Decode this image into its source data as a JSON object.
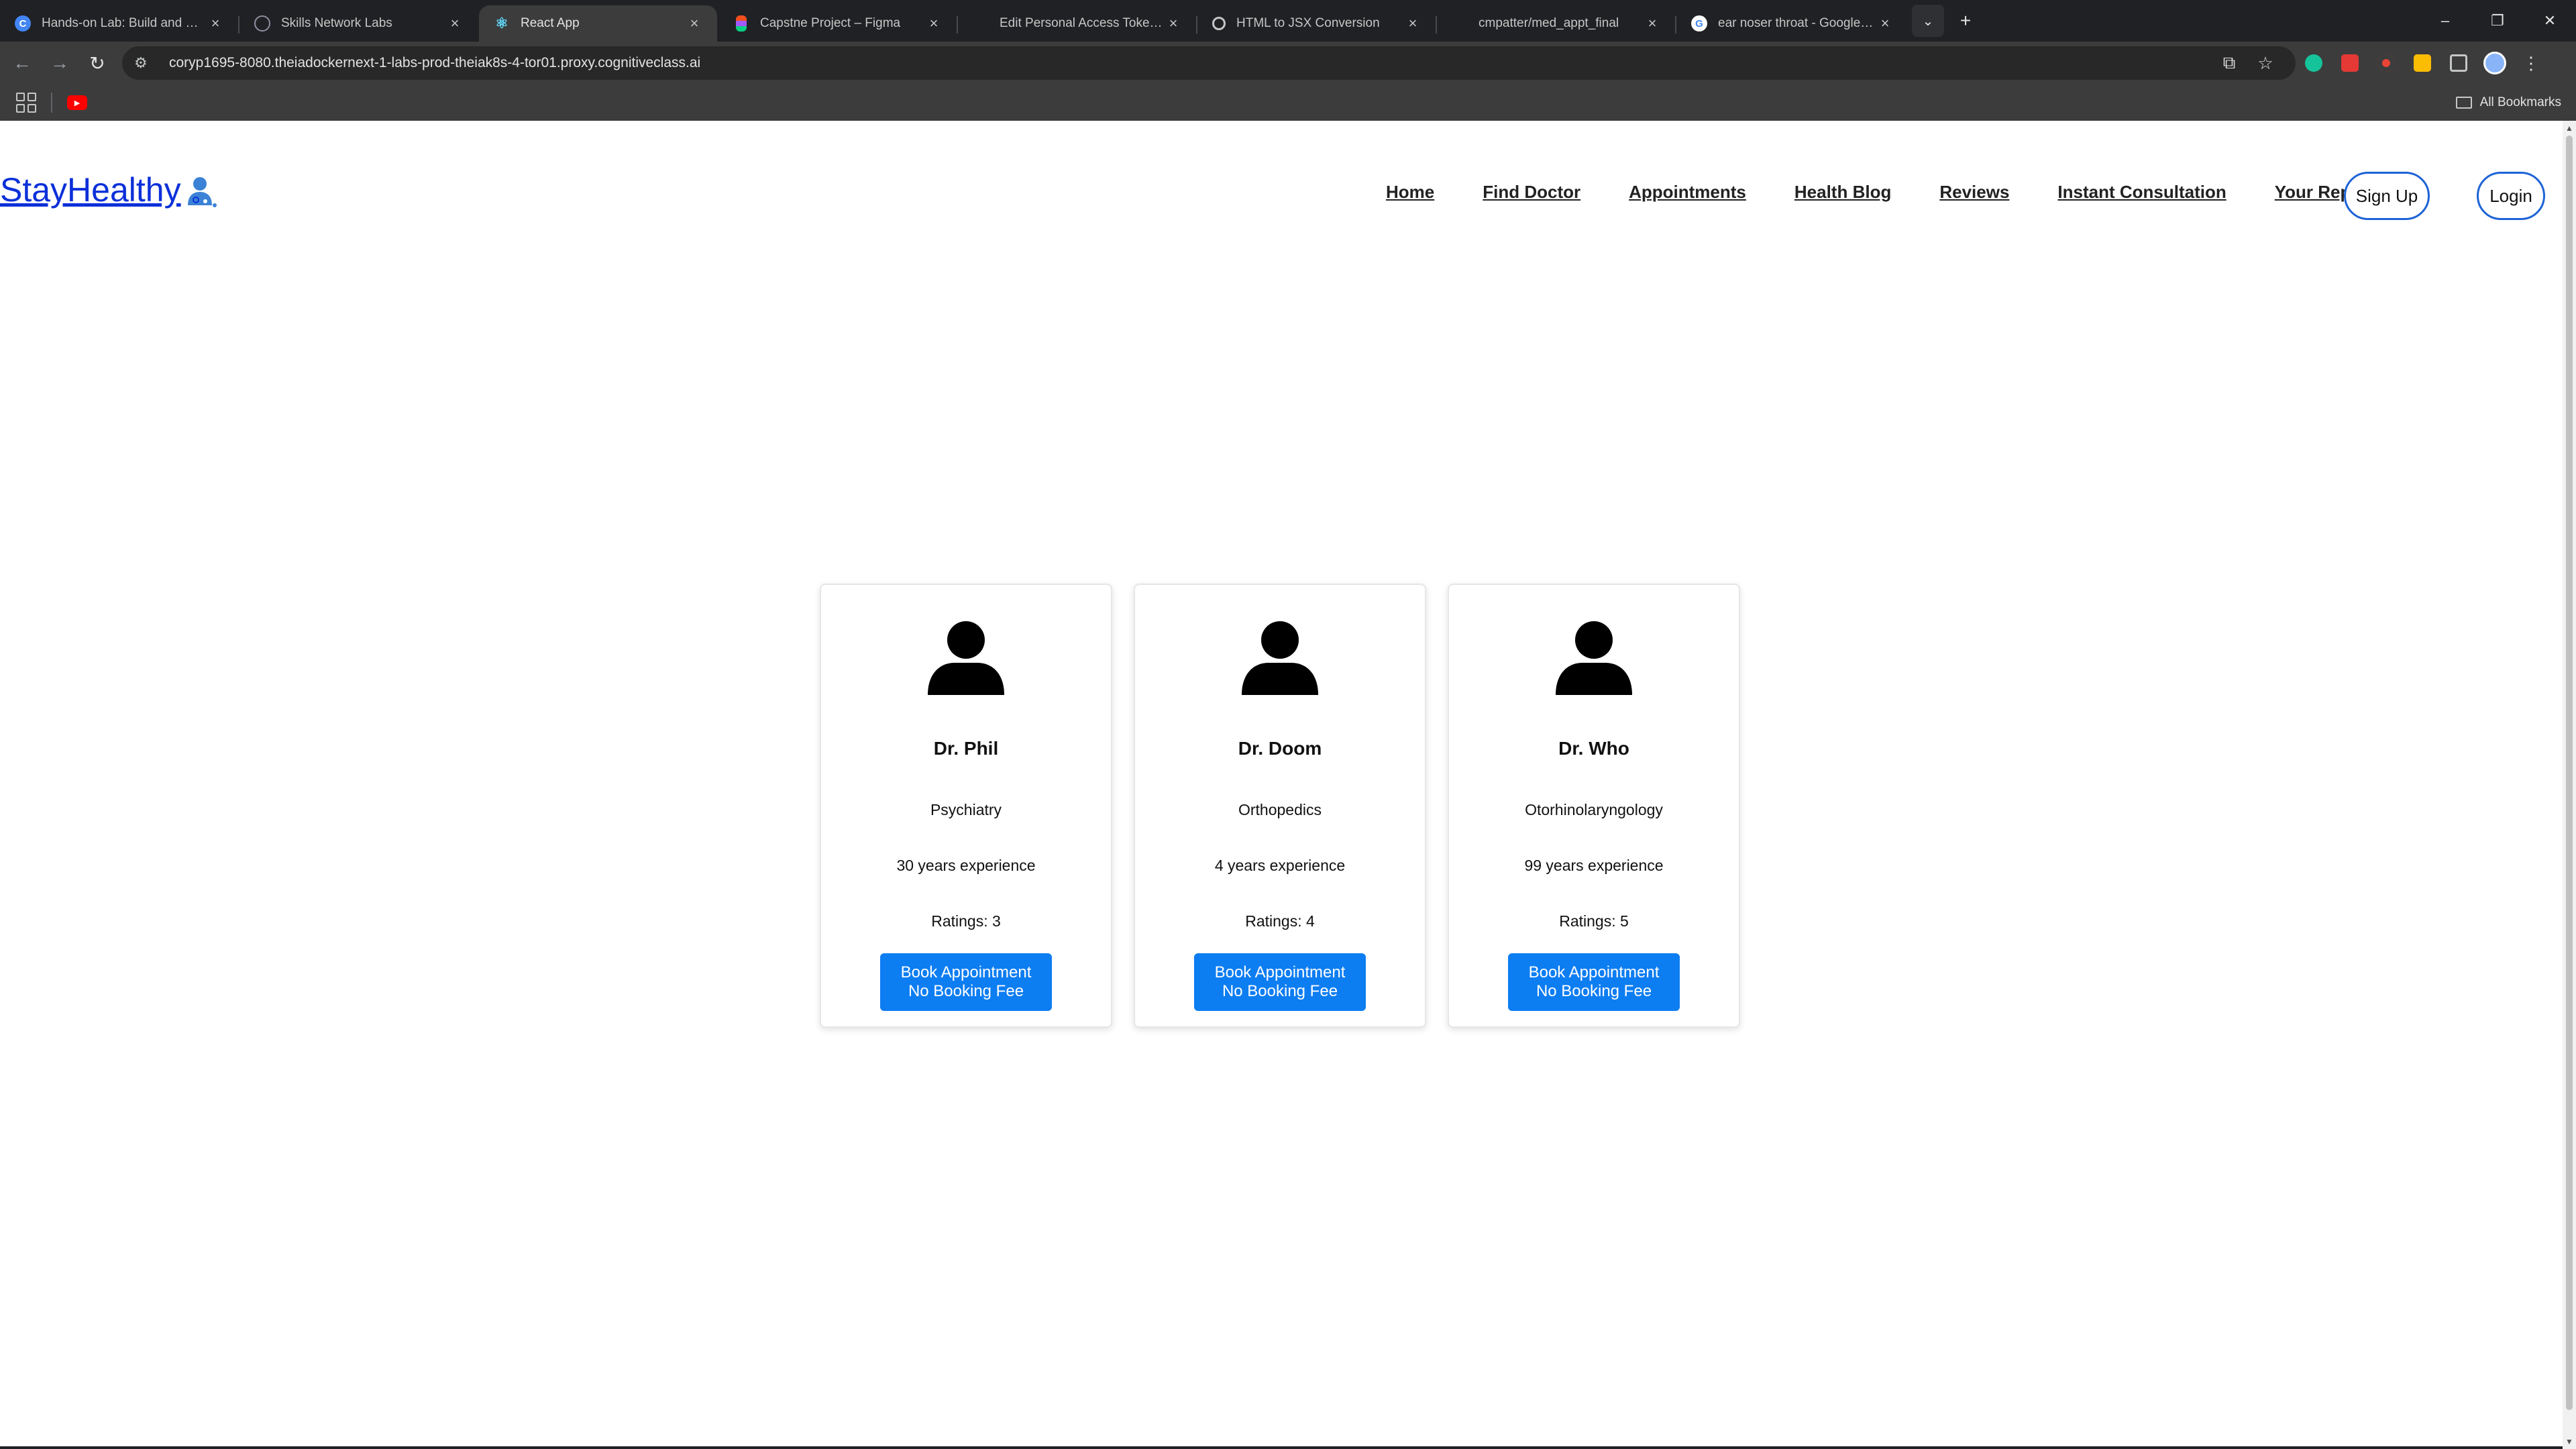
{
  "browser": {
    "tabs": [
      {
        "title": "Hands-on Lab: Build and Deplo",
        "favicon_color": "#4285f4",
        "favicon": "C"
      },
      {
        "title": "Skills Network Labs",
        "favicon_color": "#8e8ea0",
        "favicon": ""
      },
      {
        "title": "React App",
        "favicon_color": "#61dafb",
        "favicon": "⚛"
      },
      {
        "title": "Capstne Project – Figma",
        "favicon_color": "#f24e1e",
        "favicon": ""
      },
      {
        "title": "Edit Personal Access Token (Cla",
        "favicon_color": "#202124",
        "favicon": ""
      },
      {
        "title": "HTML to JSX Conversion",
        "favicon_color": "#c4c7c5",
        "favicon": ""
      },
      {
        "title": "cmpatter/med_appt_final",
        "favicon_color": "#202124",
        "favicon": ""
      },
      {
        "title": "ear noser throat - Google Searc",
        "favicon_color": "#ffffff",
        "favicon": "G"
      }
    ],
    "active_tab_index": 2,
    "url": "coryp1695-8080.theiadockernext-1-labs-prod-theiak8s-4-tor01.proxy.cognitiveclass.ai",
    "all_bookmarks": "All Bookmarks"
  },
  "site": {
    "brand": "StayHealthy",
    "nav": {
      "home": "Home",
      "find_doctor": "Find Doctor",
      "appointments": "Appointments",
      "health_blog": "Health Blog",
      "reviews": "Reviews",
      "instant_consultation": "Instant Consultation",
      "your_reports": "Your Reports",
      "sign_up": "Sign Up",
      "login": "Login"
    }
  },
  "doctors": [
    {
      "name": "Dr. Phil",
      "speciality": "Psychiatry",
      "experience": "30 years experience",
      "ratings": "Ratings: 3",
      "button_line1": "Book Appointment",
      "button_line2": "No Booking Fee"
    },
    {
      "name": "Dr. Doom",
      "speciality": "Orthopedics",
      "experience": "4 years experience",
      "ratings": "Ratings: 4",
      "button_line1": "Book Appointment",
      "button_line2": "No Booking Fee"
    },
    {
      "name": "Dr. Who",
      "speciality": "Otorhinolaryngology",
      "experience": "99 years experience",
      "ratings": "Ratings: 5",
      "button_line1": "Book Appointment",
      "button_line2": "No Booking Fee"
    }
  ],
  "colors": {
    "brand": "#0b30d9",
    "button": "#0d7df2",
    "pill_border": "#1e63d6"
  }
}
